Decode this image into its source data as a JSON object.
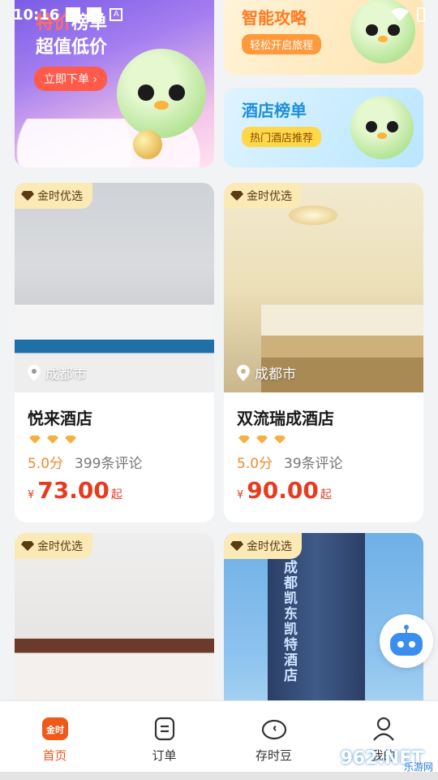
{
  "status_bar": {
    "time": "10:16"
  },
  "banners": {
    "main": {
      "title": "榜单",
      "cta": "立即下单 ›",
      "subtitle": "超值低价"
    },
    "top_right": {
      "title": "智能攻略",
      "tag": "轻松开启旅程"
    },
    "bottom_right": {
      "title": "酒店榜单",
      "tag": "热门酒店推荐"
    }
  },
  "hotels": [
    {
      "badge": "金时优选",
      "city": "成都市",
      "name": "悦来酒店",
      "score": "5.0分",
      "reviews": "399条评论",
      "currency": "¥",
      "price": "73.00",
      "suffix": "起",
      "stars": 3
    },
    {
      "badge": "金时优选",
      "city": "成都市",
      "name": "双流瑞成酒店",
      "score": "5.0分",
      "reviews": "39条评论",
      "currency": "¥",
      "price": "90.00",
      "suffix": "起",
      "stars": 3
    },
    {
      "badge": "金时优选"
    },
    {
      "badge": "金时优选",
      "building_text": "成都凯东凯特酒店"
    }
  ],
  "nav": [
    {
      "label": "首页",
      "icon": "home-logo-icon",
      "active": true
    },
    {
      "label": "订单",
      "icon": "order-list-icon",
      "active": false
    },
    {
      "label": "存时豆",
      "icon": "piggy-bank-icon",
      "active": false
    },
    {
      "label": "我的",
      "icon": "user-icon",
      "active": false
    }
  ],
  "watermark": {
    "text": "962.NET",
    "sub": "乐游网"
  },
  "colors": {
    "accent": "#ef5a1a",
    "price": "#e83a1f",
    "score": "#f08a2c",
    "badge_bg": "#fbe9b6"
  }
}
